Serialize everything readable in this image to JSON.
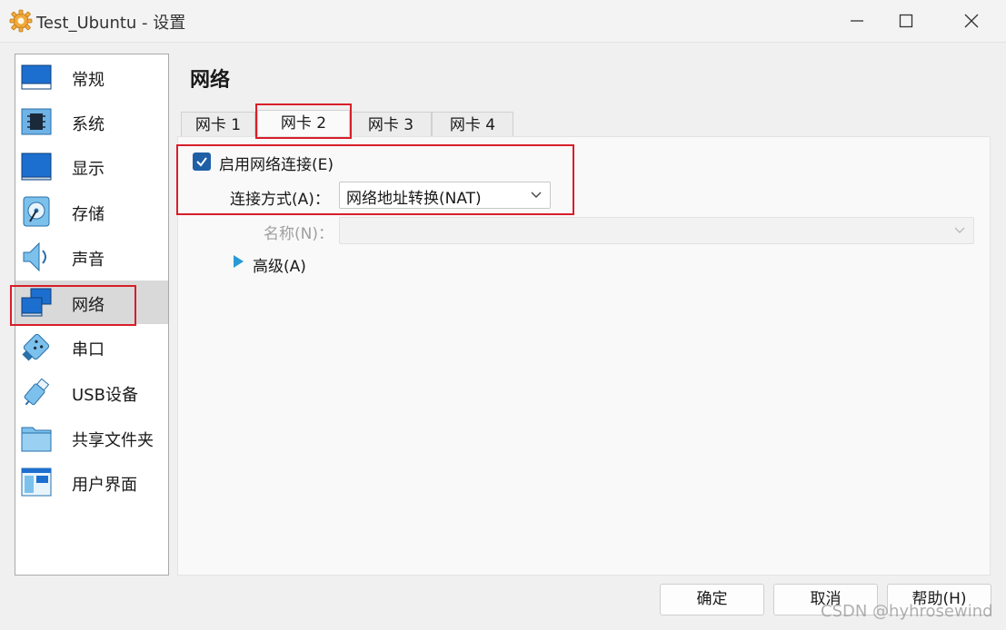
{
  "window": {
    "title": "Test_Ubuntu - 设置",
    "icon": "gear-icon",
    "controls": [
      "minimize-icon",
      "maximize-icon",
      "close-icon"
    ]
  },
  "sidebar": {
    "items": [
      {
        "label": "常规",
        "icon": "general-icon"
      },
      {
        "label": "系统",
        "icon": "chip-icon"
      },
      {
        "label": "显示",
        "icon": "monitor-icon"
      },
      {
        "label": "存储",
        "icon": "disk-icon"
      },
      {
        "label": "声音",
        "icon": "speaker-icon"
      },
      {
        "label": "网络",
        "icon": "network-icon",
        "selected": true
      },
      {
        "label": "串口",
        "icon": "serial-port-icon"
      },
      {
        "label": "USB设备",
        "icon": "usb-icon"
      },
      {
        "label": "共享文件夹",
        "icon": "folder-icon"
      },
      {
        "label": "用户界面",
        "icon": "user-interface-icon"
      }
    ]
  },
  "main": {
    "title": "网络",
    "tabs": [
      {
        "label": "网卡 1"
      },
      {
        "label": "网卡 2",
        "active": true
      },
      {
        "label": "网卡 3"
      },
      {
        "label": "网卡 4"
      }
    ],
    "enable_checkbox": {
      "label": "启用网络连接(E)",
      "checked": true
    },
    "attached_to": {
      "label": "连接方式(A)：",
      "value": "网络地址转换(NAT)"
    },
    "name": {
      "label": "名称(N)：",
      "value": "",
      "disabled": true
    },
    "advanced": {
      "label": "高级(A)"
    }
  },
  "buttons": {
    "ok": "确定",
    "cancel": "取消",
    "help": "帮助(H)"
  },
  "watermark": "CSDN @hyhrosewind",
  "colors": {
    "accent": "#1f5fa6",
    "highlight_box": "#d81e2a",
    "selected_item": "#d9d9d9"
  }
}
